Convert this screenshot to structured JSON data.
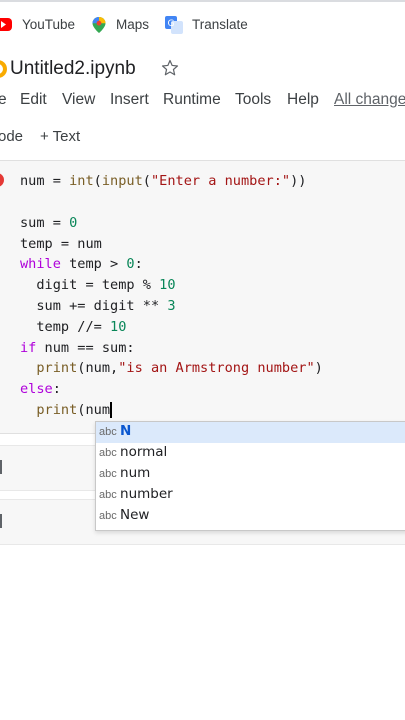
{
  "bookmarks": [
    {
      "label": "YouTube",
      "icon": "youtube-icon"
    },
    {
      "label": "Maps",
      "icon": "maps-icon"
    },
    {
      "label": "Translate",
      "icon": "translate-icon"
    }
  ],
  "notebook": {
    "title": "Untitled2.ipynb"
  },
  "menu": {
    "file": "e",
    "edit": "Edit",
    "view": "View",
    "insert": "Insert",
    "runtime": "Runtime",
    "tools": "Tools",
    "help": "Help",
    "all_changes": "All changes"
  },
  "toolbar": {
    "code": "ode",
    "text": "+ Text"
  },
  "code_lines": [
    "num = int(input(\"Enter a number:\"))",
    "",
    "sum = 0",
    "temp = num",
    "while temp > 0:",
    "  digit = temp % 10",
    "  sum += digit ** 3",
    "  temp //= 10",
    "if num == sum:",
    "  print(num,\"is an Armstrong number\")",
    "else:",
    "  print(num"
  ],
  "autocomplete": {
    "type_label": "abc",
    "items": [
      {
        "match": "N",
        "rest": ""
      },
      {
        "match": "n",
        "rest": "ormal"
      },
      {
        "match": "n",
        "rest": "um"
      },
      {
        "match": "n",
        "rest": "umber"
      },
      {
        "match": "N",
        "rest": "ew"
      }
    ],
    "selected_index": 0
  },
  "colors": {
    "accent": "#0b57d0",
    "keyword": "#af00db",
    "number": "#098658",
    "string": "#a31515"
  }
}
